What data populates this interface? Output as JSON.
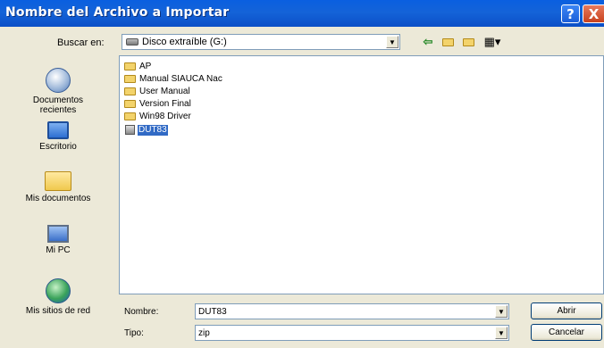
{
  "window": {
    "title": "Nombre del Archivo a Importar",
    "help_glyph": "?",
    "close_glyph": "X"
  },
  "lookin": {
    "label": "Buscar en:",
    "value": "Disco extraíble (G:)"
  },
  "toolbar": {
    "back_icon": "back-arrow-icon",
    "up_icon": "up-folder-icon",
    "new_folder_icon": "new-folder-icon",
    "views_icon": "views-menu-icon"
  },
  "places": [
    {
      "label": "Documentos\nrecientes",
      "icon": "recent-documents-icon"
    },
    {
      "label": "Escritorio",
      "icon": "desktop-icon"
    },
    {
      "label": "Mis documentos",
      "icon": "my-documents-icon"
    },
    {
      "label": "Mi PC",
      "icon": "my-computer-icon"
    },
    {
      "label": "Mis sitios de red",
      "icon": "network-places-icon"
    }
  ],
  "files": [
    {
      "name": "AP",
      "type": "folder"
    },
    {
      "name": "Manual SIAUCA Nac",
      "type": "folder"
    },
    {
      "name": "User Manual",
      "type": "folder"
    },
    {
      "name": "Version Final",
      "type": "folder"
    },
    {
      "name": "Win98 Driver",
      "type": "folder"
    },
    {
      "name": "DUT83",
      "type": "file",
      "selected": true
    }
  ],
  "filename": {
    "label": "Nombre:",
    "value": "DUT83"
  },
  "filetype": {
    "label": "Tipo:",
    "value": "zip"
  },
  "buttons": {
    "open": "Abrir",
    "cancel": "Cancelar"
  },
  "colors": {
    "titlebar": "#0a5fe0",
    "selection": "#316ac5",
    "face": "#ece9d8"
  }
}
